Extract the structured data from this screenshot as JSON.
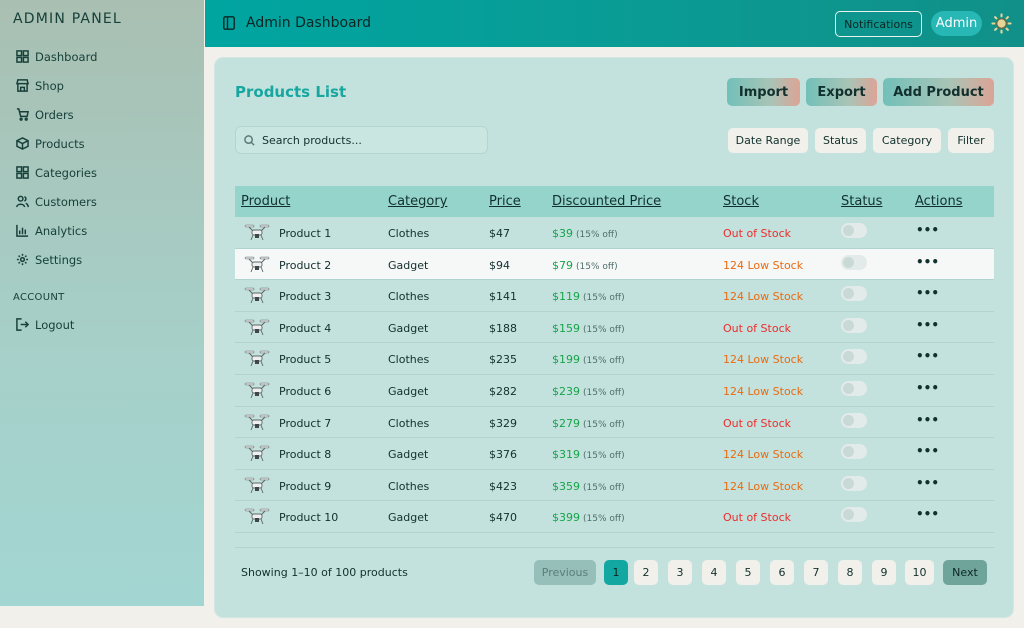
{
  "sidebar": {
    "brand": "ADMIN PANEL",
    "items": [
      {
        "label": "Dashboard",
        "icon": "grid-icon"
      },
      {
        "label": "Shop",
        "icon": "store-icon"
      },
      {
        "label": "Orders",
        "icon": "cart-icon"
      },
      {
        "label": "Products",
        "icon": "box-icon"
      },
      {
        "label": "Categories",
        "icon": "grid-icon"
      },
      {
        "label": "Customers",
        "icon": "users-icon"
      },
      {
        "label": "Analytics",
        "icon": "chart-icon"
      },
      {
        "label": "Settings",
        "icon": "gear-icon"
      }
    ],
    "account_label": "ACCOUNT",
    "logout_label": "Logout"
  },
  "header": {
    "title": "Admin Dashboard",
    "notifications_label": "Notifications",
    "admin_label": "Admin"
  },
  "products": {
    "title": "Products List",
    "import_label": "Import",
    "export_label": "Export",
    "add_label": "Add Product",
    "search_placeholder": "Search products...",
    "filters": [
      "Date Range",
      "Status",
      "Category",
      "Filter"
    ],
    "columns": [
      "Product",
      "Category",
      "Price",
      "Discounted Price",
      "Stock",
      "Status",
      "Actions"
    ],
    "rows": [
      {
        "name": "Product 1",
        "category": "Clothes",
        "price": "$47",
        "discounted": "$39",
        "off": "(15% off)",
        "stock": "Out of Stock",
        "stock_type": "out"
      },
      {
        "name": "Product 2",
        "category": "Gadget",
        "price": "$94",
        "discounted": "$79",
        "off": "(15% off)",
        "stock": "124 Low Stock",
        "stock_type": "low"
      },
      {
        "name": "Product 3",
        "category": "Clothes",
        "price": "$141",
        "discounted": "$119",
        "off": "(15% off)",
        "stock": "124 Low Stock",
        "stock_type": "low"
      },
      {
        "name": "Product 4",
        "category": "Gadget",
        "price": "$188",
        "discounted": "$159",
        "off": "(15% off)",
        "stock": "Out of Stock",
        "stock_type": "out"
      },
      {
        "name": "Product 5",
        "category": "Clothes",
        "price": "$235",
        "discounted": "$199",
        "off": "(15% off)",
        "stock": "124 Low Stock",
        "stock_type": "low"
      },
      {
        "name": "Product 6",
        "category": "Gadget",
        "price": "$282",
        "discounted": "$239",
        "off": "(15% off)",
        "stock": "124 Low Stock",
        "stock_type": "low"
      },
      {
        "name": "Product 7",
        "category": "Clothes",
        "price": "$329",
        "discounted": "$279",
        "off": "(15% off)",
        "stock": "Out of Stock",
        "stock_type": "out"
      },
      {
        "name": "Product 8",
        "category": "Gadget",
        "price": "$376",
        "discounted": "$319",
        "off": "(15% off)",
        "stock": "124 Low Stock",
        "stock_type": "low"
      },
      {
        "name": "Product 9",
        "category": "Clothes",
        "price": "$423",
        "discounted": "$359",
        "off": "(15% off)",
        "stock": "124 Low Stock",
        "stock_type": "low"
      },
      {
        "name": "Product 10",
        "category": "Gadget",
        "price": "$470",
        "discounted": "$399",
        "off": "(15% off)",
        "stock": "Out of Stock",
        "stock_type": "out"
      }
    ],
    "actions_glyph": "•••",
    "showing_text": "Showing 1–10 of 100 products",
    "pagination": {
      "previous": "Previous",
      "pages": [
        "1",
        "2",
        "3",
        "4",
        "5",
        "6",
        "7",
        "8",
        "9",
        "10"
      ],
      "current": "1",
      "next": "Next"
    }
  },
  "colors": {
    "accent": "#13a7a2",
    "discount": "#16a34a",
    "out_of_stock": "#ef2b2b",
    "low_stock": "#ea6a10"
  }
}
